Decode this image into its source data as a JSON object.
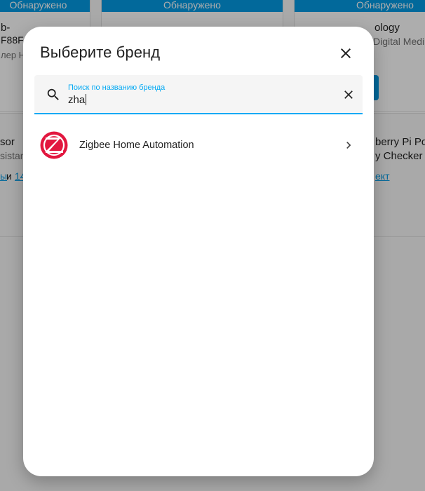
{
  "background": {
    "cards": [
      {
        "badge": "Обнаружено",
        "line1": "b-",
        "line2": "F88F",
        "line3": "лер H"
      },
      {
        "badge": "Обнаружено"
      },
      {
        "badge": "Обнаружено",
        "line1": "ology",
        "line2": "Digital Medi"
      }
    ],
    "row2": {
      "left_title": "sor",
      "left_sub": "sistan",
      "left_link1": "ы",
      "left_and": "и",
      "left_link2": "14",
      "right_title1": "berry Pi Po",
      "right_title2": "y Checker",
      "right_link": "ект"
    }
  },
  "dialog": {
    "title": "Выберите бренд",
    "search": {
      "label": "Поиск по названию бренда",
      "value": "zha"
    },
    "results": [
      {
        "label": "Zigbee Home Automation",
        "icon": "zha-logo"
      }
    ]
  },
  "colors": {
    "accent": "#03a9f4",
    "zha_red": "#e2173f"
  }
}
